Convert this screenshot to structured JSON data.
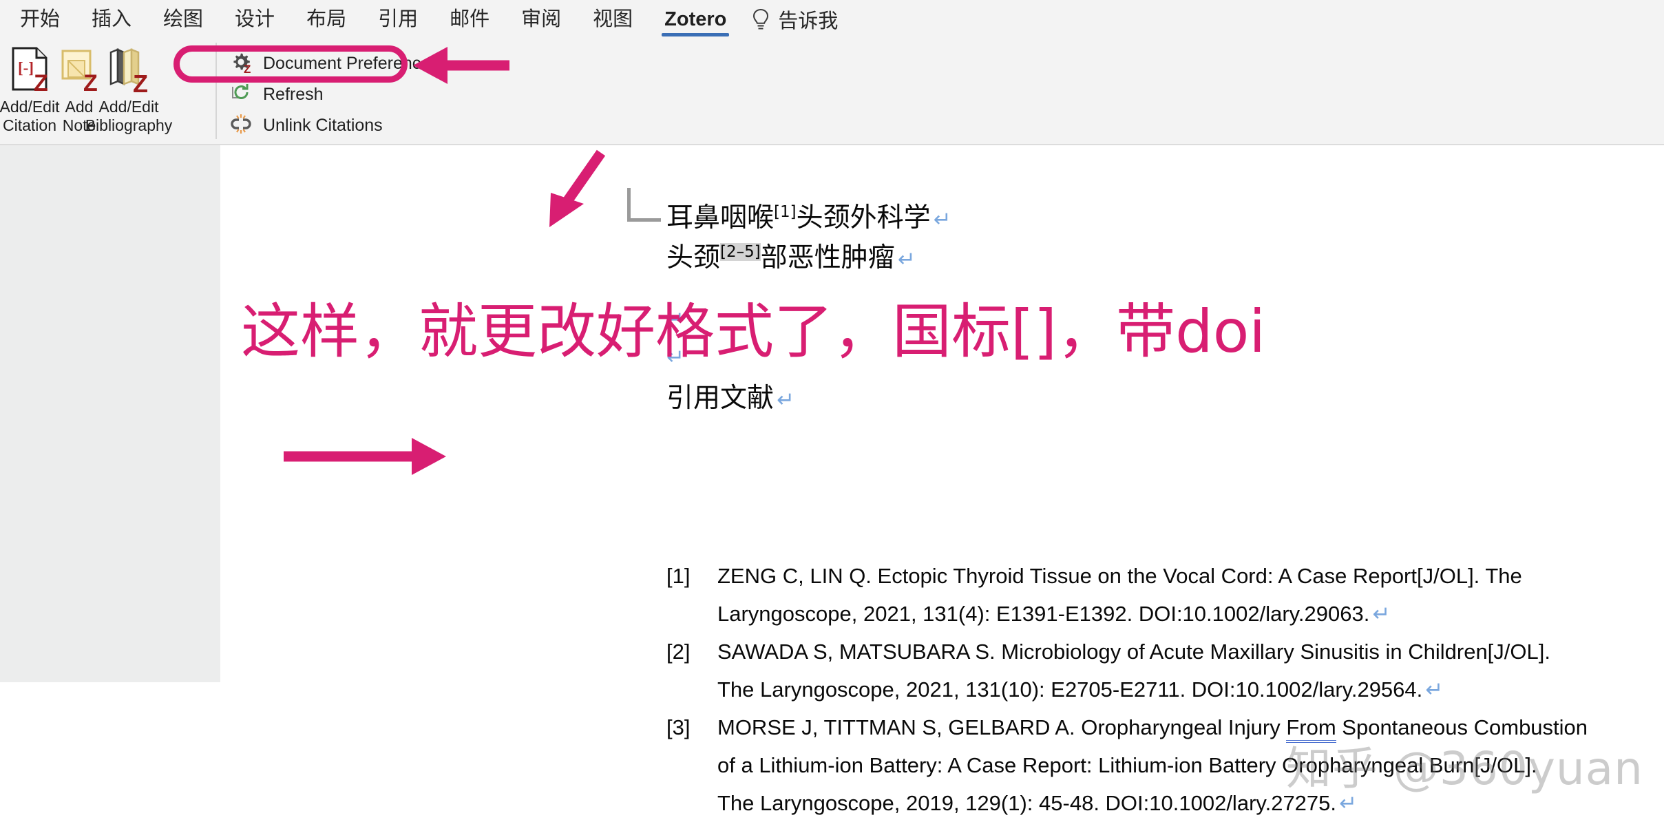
{
  "ribbon": {
    "tabs": [
      {
        "label": "开始",
        "active": false
      },
      {
        "label": "插入",
        "active": false
      },
      {
        "label": "绘图",
        "active": false
      },
      {
        "label": "设计",
        "active": false
      },
      {
        "label": "布局",
        "active": false
      },
      {
        "label": "引用",
        "active": false
      },
      {
        "label": "邮件",
        "active": false
      },
      {
        "label": "审阅",
        "active": false
      },
      {
        "label": "视图",
        "active": false
      },
      {
        "label": "Zotero",
        "active": true
      }
    ],
    "tell_me": {
      "icon": "lightbulb-icon",
      "label": "告诉我"
    },
    "big_buttons": [
      {
        "label": "Add/Edit\nCitation",
        "icon": "add-edit-citation-icon"
      },
      {
        "label": "Add\nNote",
        "icon": "add-note-icon"
      },
      {
        "label": "Add/Edit\nBibliography",
        "icon": "add-edit-bibliography-icon"
      }
    ],
    "small_buttons": [
      {
        "label": "Document Preferences",
        "icon": "gear-z-icon"
      },
      {
        "label": "Refresh",
        "icon": "refresh-icon"
      },
      {
        "label": "Unlink Citations",
        "icon": "unlink-icon"
      }
    ]
  },
  "annotations": {
    "highlight_color": "#d81e72",
    "callout_text": "这样，就更改好格式了，国标[]，带doi",
    "arrow_to_document_preferences": "arrow-left-icon",
    "arrow_to_superscript_citation": "arrow-down-icon",
    "arrow_to_reference_one": "arrow-right-icon"
  },
  "document": {
    "lines": [
      {
        "text_a": "耳鼻咽喉",
        "sup": "[1]",
        "sup_shaded": false,
        "text_b": "头颈外科学",
        "mark": "↵"
      },
      {
        "text_a": "头颈",
        "sup": "[2–5]",
        "sup_shaded": true,
        "text_b": "部恶性肿瘤",
        "mark": "↵"
      }
    ],
    "heading": {
      "text": "引用文献",
      "mark": "↵"
    },
    "references": [
      {
        "num": "[1]",
        "lines": [
          "ZENG C, LIN Q. Ectopic Thyroid Tissue on the Vocal Cord: A Case Report[J/OL]. The",
          "Laryngoscope, 2021, 131(4): E1391-E1392. DOI:10.1002/lary.29063."
        ],
        "mark": "↵"
      },
      {
        "num": "[2]",
        "lines": [
          "SAWADA S, MATSUBARA S. Microbiology of Acute Maxillary Sinusitis in Children[J/OL].",
          "The Laryngoscope, 2021, 131(10): E2705-E2711. DOI:10.1002/lary.29564."
        ],
        "mark": "↵"
      },
      {
        "num": "[3]",
        "lines": [
          "MORSE J, TITTMAN S, GELBARD A. Oropharyngeal Injury From Spontaneous Combustion",
          "of a Lithium-ion Battery: A Case Report: Lithium-ion Battery Oropharyngeal Burn[J/OL].",
          "The Laryngoscope, 2019, 129(1): 45-48. DOI:10.1002/lary.27275."
        ],
        "mark": "↵",
        "grammar_underlined_word": "From"
      }
    ]
  },
  "watermark": {
    "text": "知乎 @360yuan"
  }
}
